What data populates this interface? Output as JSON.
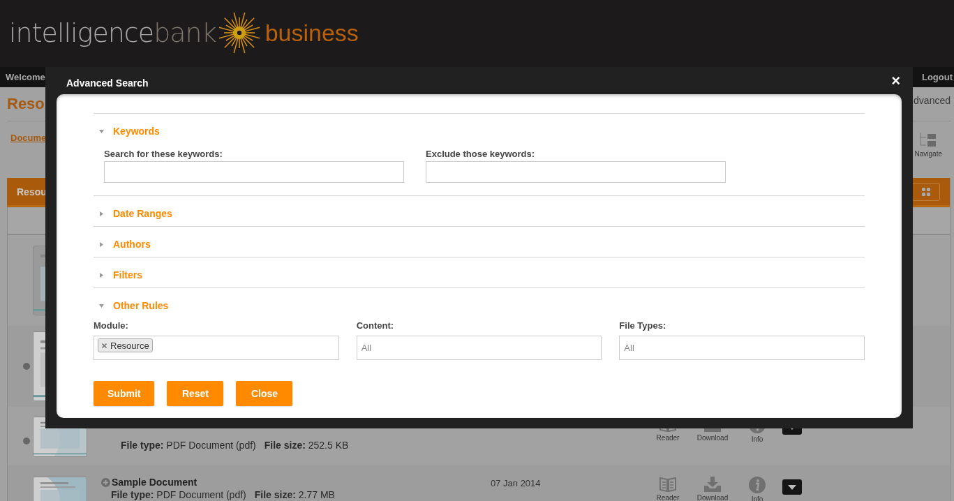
{
  "header": {
    "logo_part_1": "intelligence",
    "logo_part_2": "bank",
    "logo_part_3": "business"
  },
  "nav": {
    "welcome": "Welcome",
    "logout": "Logout"
  },
  "page": {
    "title": "Reso",
    "link": "Docume",
    "advanced": "dvanced",
    "navigate": "Navigate",
    "bar_title": "Resou"
  },
  "rows": [
    {},
    {
      "marker": true
    },
    {
      "marker": true,
      "file_type_label": "File type:",
      "file_type": "PDF Document (pdf)",
      "file_size_label": "File size:",
      "file_size": "252.5 KB",
      "actions": [
        "Reader",
        "Download",
        "Info"
      ]
    },
    {
      "name": "Sample Document",
      "file_type_label": "File type:",
      "file_type": "PDF Document (pdf)",
      "file_size_label": "File size:",
      "file_size": "2.77 MB",
      "date": "07 Jan 2014",
      "actions": [
        "Reader",
        "Download",
        "Info"
      ]
    }
  ],
  "dialog": {
    "title": "Advanced Search",
    "close": "×",
    "sections": [
      {
        "title": "Keywords",
        "expanded": true,
        "fields": [
          {
            "kind": "text",
            "label": "Search for these keywords:"
          },
          {
            "kind": "text",
            "label": "Exclude those keywords:"
          }
        ]
      },
      {
        "title": "Date Ranges",
        "expanded": false
      },
      {
        "title": "Authors",
        "expanded": false
      },
      {
        "title": "Filters",
        "expanded": false
      },
      {
        "title": "Other Rules",
        "expanded": true,
        "fields": [
          {
            "kind": "tags",
            "label": "Module:",
            "tags": [
              "Resource"
            ]
          },
          {
            "kind": "select",
            "label": "Content:",
            "placeholder": "All"
          },
          {
            "kind": "select",
            "label": "File Types:",
            "placeholder": "All"
          }
        ]
      }
    ],
    "buttons": [
      "Submit",
      "Reset",
      "Close"
    ]
  }
}
